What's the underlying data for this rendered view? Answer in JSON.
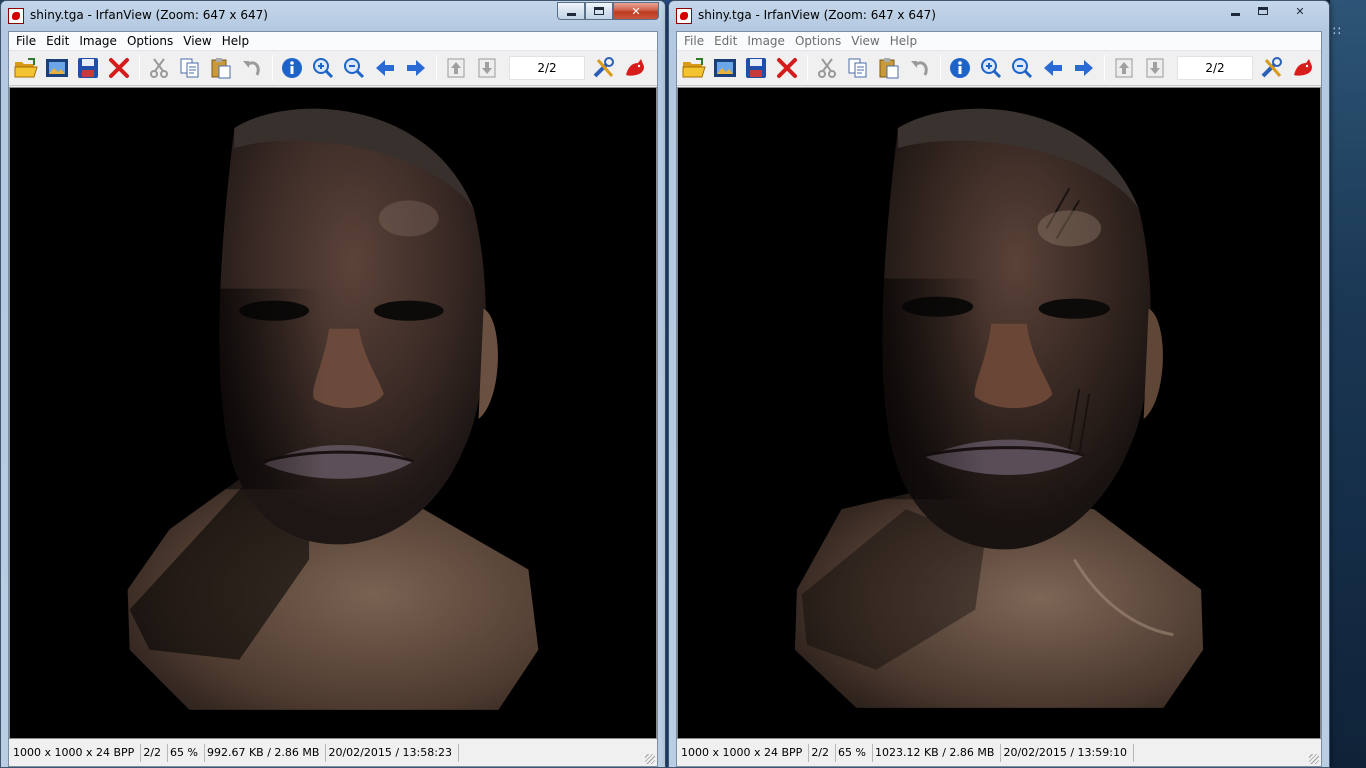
{
  "desktop": {
    "right_edge_glyph": "∷"
  },
  "windows": [
    {
      "title": "shiny.tga - IrfanView (Zoom: 647 x 647)",
      "app_icon": "irfanview-icon",
      "menu": [
        "File",
        "Edit",
        "Image",
        "Options",
        "View",
        "Help"
      ],
      "toolbar": {
        "page_indicator": "2/2"
      },
      "image": {
        "subject": "shiny.tga",
        "variant": "smooth"
      },
      "status": {
        "dimensions": "1000 x 1000 x 24 BPP",
        "page": "2/2",
        "zoom": "65 %",
        "size": "992.67 KB / 2.86 MB",
        "datetime": "20/02/2015 / 13:58:23"
      },
      "active": true
    },
    {
      "title": "shiny.tga - IrfanView (Zoom: 647 x 647)",
      "app_icon": "irfanview-icon",
      "menu": [
        "File",
        "Edit",
        "Image",
        "Options",
        "View",
        "Help"
      ],
      "toolbar": {
        "page_indicator": "2/2"
      },
      "image": {
        "subject": "shiny.tga",
        "variant": "detailed"
      },
      "status": {
        "dimensions": "1000 x 1000 x 24 BPP",
        "page": "2/2",
        "zoom": "65 %",
        "size": "1023.12 KB / 2.86 MB",
        "datetime": "20/02/2015 / 13:59:10"
      },
      "active": false
    }
  ],
  "toolbar_icons": [
    "open-folder-icon",
    "slideshow-icon",
    "save-icon",
    "delete-icon",
    "cut-icon",
    "copy-icon",
    "paste-icon",
    "undo-icon",
    "info-icon",
    "zoom-in-icon",
    "zoom-out-icon",
    "previous-icon",
    "next-icon",
    "page-up-icon",
    "page-down-icon",
    "settings-icon",
    "irfanview-cat-icon"
  ],
  "colors": {
    "title_active": "#c4d6ea",
    "close_button": "#c9553b",
    "image_background": "#000000",
    "skin_mid": "#4a352c",
    "skin_light": "#7a6252"
  }
}
